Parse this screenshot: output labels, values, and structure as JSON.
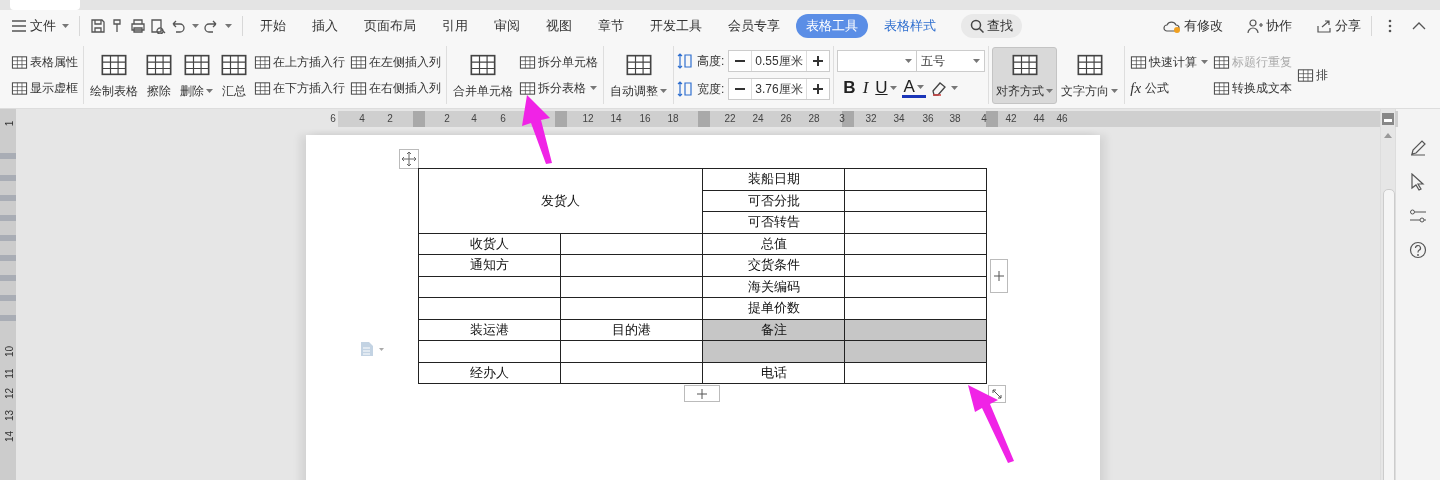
{
  "menu": {
    "file": "文件",
    "tabs": [
      {
        "label": "开始",
        "kind": "normal",
        "selected": false
      },
      {
        "label": "插入",
        "kind": "normal",
        "selected": false
      },
      {
        "label": "页面布局",
        "kind": "normal",
        "selected": false
      },
      {
        "label": "引用",
        "kind": "normal",
        "selected": false
      },
      {
        "label": "审阅",
        "kind": "normal",
        "selected": false
      },
      {
        "label": "视图",
        "kind": "normal",
        "selected": false
      },
      {
        "label": "章节",
        "kind": "normal",
        "selected": false
      },
      {
        "label": "开发工具",
        "kind": "normal",
        "selected": false
      },
      {
        "label": "会员专享",
        "kind": "normal",
        "selected": false
      },
      {
        "label": "表格工具",
        "kind": "context",
        "selected": true
      },
      {
        "label": "表格样式",
        "kind": "context",
        "selected": false
      }
    ],
    "search": "查找",
    "actions": [
      "有修改",
      "协作",
      "分享"
    ]
  },
  "ribbon": {
    "groups": [
      {
        "columns": [
          [
            {
              "kind": "small",
              "label": "表格属性",
              "dropdown": false,
              "pressed": false,
              "disabled": false
            },
            {
              "kind": "small",
              "label": "显示虚框",
              "dropdown": false,
              "pressed": false,
              "disabled": false
            }
          ]
        ]
      },
      {
        "columns": [
          [
            {
              "kind": "big",
              "label": "绘制表格",
              "dropdown": false,
              "pressed": false,
              "disabled": false
            }
          ],
          [
            {
              "kind": "big",
              "label": "擦除",
              "dropdown": false,
              "pressed": false,
              "disabled": false
            }
          ],
          [
            {
              "kind": "big",
              "label": "删除",
              "dropdown": true,
              "pressed": false,
              "disabled": false
            }
          ],
          [
            {
              "kind": "big",
              "label": "汇总",
              "dropdown": false,
              "pressed": false,
              "disabled": false
            }
          ],
          [
            {
              "kind": "small",
              "label": "在上方插入行",
              "dropdown": false,
              "pressed": false,
              "disabled": false
            },
            {
              "kind": "small",
              "label": "在下方插入行",
              "dropdown": false,
              "pressed": false,
              "disabled": false
            }
          ],
          [
            {
              "kind": "small",
              "label": "在左侧插入列",
              "dropdown": false,
              "pressed": false,
              "disabled": false
            },
            {
              "kind": "small",
              "label": "在右侧插入列",
              "dropdown": false,
              "pressed": false,
              "disabled": false
            }
          ]
        ]
      },
      {
        "columns": [
          [
            {
              "kind": "big",
              "label": "合并单元格",
              "dropdown": false,
              "pressed": false,
              "disabled": false
            }
          ],
          [
            {
              "kind": "small",
              "label": "拆分单元格",
              "dropdown": false,
              "pressed": false,
              "disabled": false
            },
            {
              "kind": "small",
              "label": "拆分表格",
              "dropdown": true,
              "pressed": false,
              "disabled": false
            }
          ]
        ]
      },
      {
        "columns": [
          [
            {
              "kind": "big",
              "label": "自动调整",
              "dropdown": true,
              "pressed": false,
              "disabled": false
            }
          ]
        ]
      },
      {
        "columns": [
          [
            {
              "kind": "spinner",
              "label": "高度:",
              "value": "0.55厘米"
            },
            {
              "kind": "spinner",
              "label": "宽度:",
              "value": "3.76厘米"
            }
          ]
        ]
      },
      {
        "columns": [
          [
            {
              "kind": "font",
              "size": "五号"
            },
            {
              "kind": "format",
              "buttons": [
                {
                  "label": "B",
                  "dropdown": false
                },
                {
                  "label": "I",
                  "dropdown": false
                },
                {
                  "label": "U",
                  "dropdown": true
                },
                {
                  "label": "A",
                  "dropdown": true
                },
                {
                  "dropdown": true
                }
              ]
            }
          ]
        ]
      },
      {
        "columns": [
          [
            {
              "kind": "big",
              "label": "对齐方式",
              "dropdown": true,
              "pressed": true,
              "disabled": false
            }
          ],
          [
            {
              "kind": "big",
              "label": "文字方向",
              "dropdown": true,
              "pressed": false,
              "disabled": false
            }
          ]
        ]
      },
      {
        "columns": [
          [
            {
              "kind": "small",
              "label": "快速计算",
              "dropdown": true,
              "pressed": false,
              "disabled": false
            },
            {
              "kind": "small",
              "label": "公式",
              "prefix": "fx",
              "dropdown": false,
              "pressed": false,
              "disabled": false
            }
          ],
          [
            {
              "kind": "small",
              "label": "标题行重复",
              "dropdown": false,
              "pressed": false,
              "disabled": true
            },
            {
              "kind": "small",
              "label": "转换成文本",
              "dropdown": false,
              "pressed": false,
              "disabled": false
            }
          ],
          [
            {
              "kind": "small",
              "label": "排",
              "dropdown": false,
              "pressed": false,
              "disabled": false
            }
          ]
        ]
      }
    ]
  },
  "ruler": {
    "labels": [
      "6",
      "4",
      "2",
      "2",
      "4",
      "6",
      "12",
      "14",
      "16",
      "18",
      "22",
      "24",
      "26",
      "28",
      "3",
      "32",
      "34",
      "36",
      "38",
      "4",
      "42",
      "44",
      "46"
    ]
  },
  "vertical_ruler": {
    "labels": [
      "1",
      "10",
      "11",
      "12",
      "13",
      "14"
    ]
  },
  "table": {
    "rows": [
      {
        "cells": [
          {
            "text": "发货人",
            "colspan": 2,
            "rowspan": 3,
            "selected": false
          },
          {
            "text": "装船日期",
            "selected": false
          },
          {
            "selected": false
          }
        ]
      },
      {
        "cells": [
          {
            "text": "可否分批",
            "selected": false
          },
          {
            "selected": false
          }
        ]
      },
      {
        "cells": [
          {
            "text": "可否转告",
            "selected": false
          },
          {
            "selected": false
          }
        ]
      },
      {
        "cells": [
          {
            "text": "收货人",
            "selected": false
          },
          {
            "selected": false
          },
          {
            "text": "总值",
            "selected": false
          },
          {
            "selected": false
          }
        ]
      },
      {
        "cells": [
          {
            "text": "通知方",
            "selected": false
          },
          {
            "selected": false
          },
          {
            "text": "交货条件",
            "selected": false
          },
          {
            "selected": false
          }
        ]
      },
      {
        "cells": [
          {
            "selected": false
          },
          {
            "selected": false
          },
          {
            "text": "海关编码",
            "selected": false
          },
          {
            "selected": false
          }
        ]
      },
      {
        "cells": [
          {
            "selected": false
          },
          {
            "selected": false
          },
          {
            "text": "提单价数",
            "selected": false
          },
          {
            "selected": false
          }
        ]
      },
      {
        "cells": [
          {
            "text": "装运港",
            "selected": false
          },
          {
            "text": "目的港",
            "selected": false
          },
          {
            "text": "备注",
            "selected": true
          },
          {
            "selected": true
          }
        ]
      },
      {
        "cells": [
          {
            "selected": false
          },
          {
            "selected": false
          },
          {
            "selected": true
          },
          {
            "selected": true
          }
        ]
      },
      {
        "cells": [
          {
            "text": "经办人",
            "selected": false
          },
          {
            "selected": false
          },
          {
            "text": "电话",
            "selected": false
          },
          {
            "selected": false
          }
        ]
      }
    ]
  }
}
